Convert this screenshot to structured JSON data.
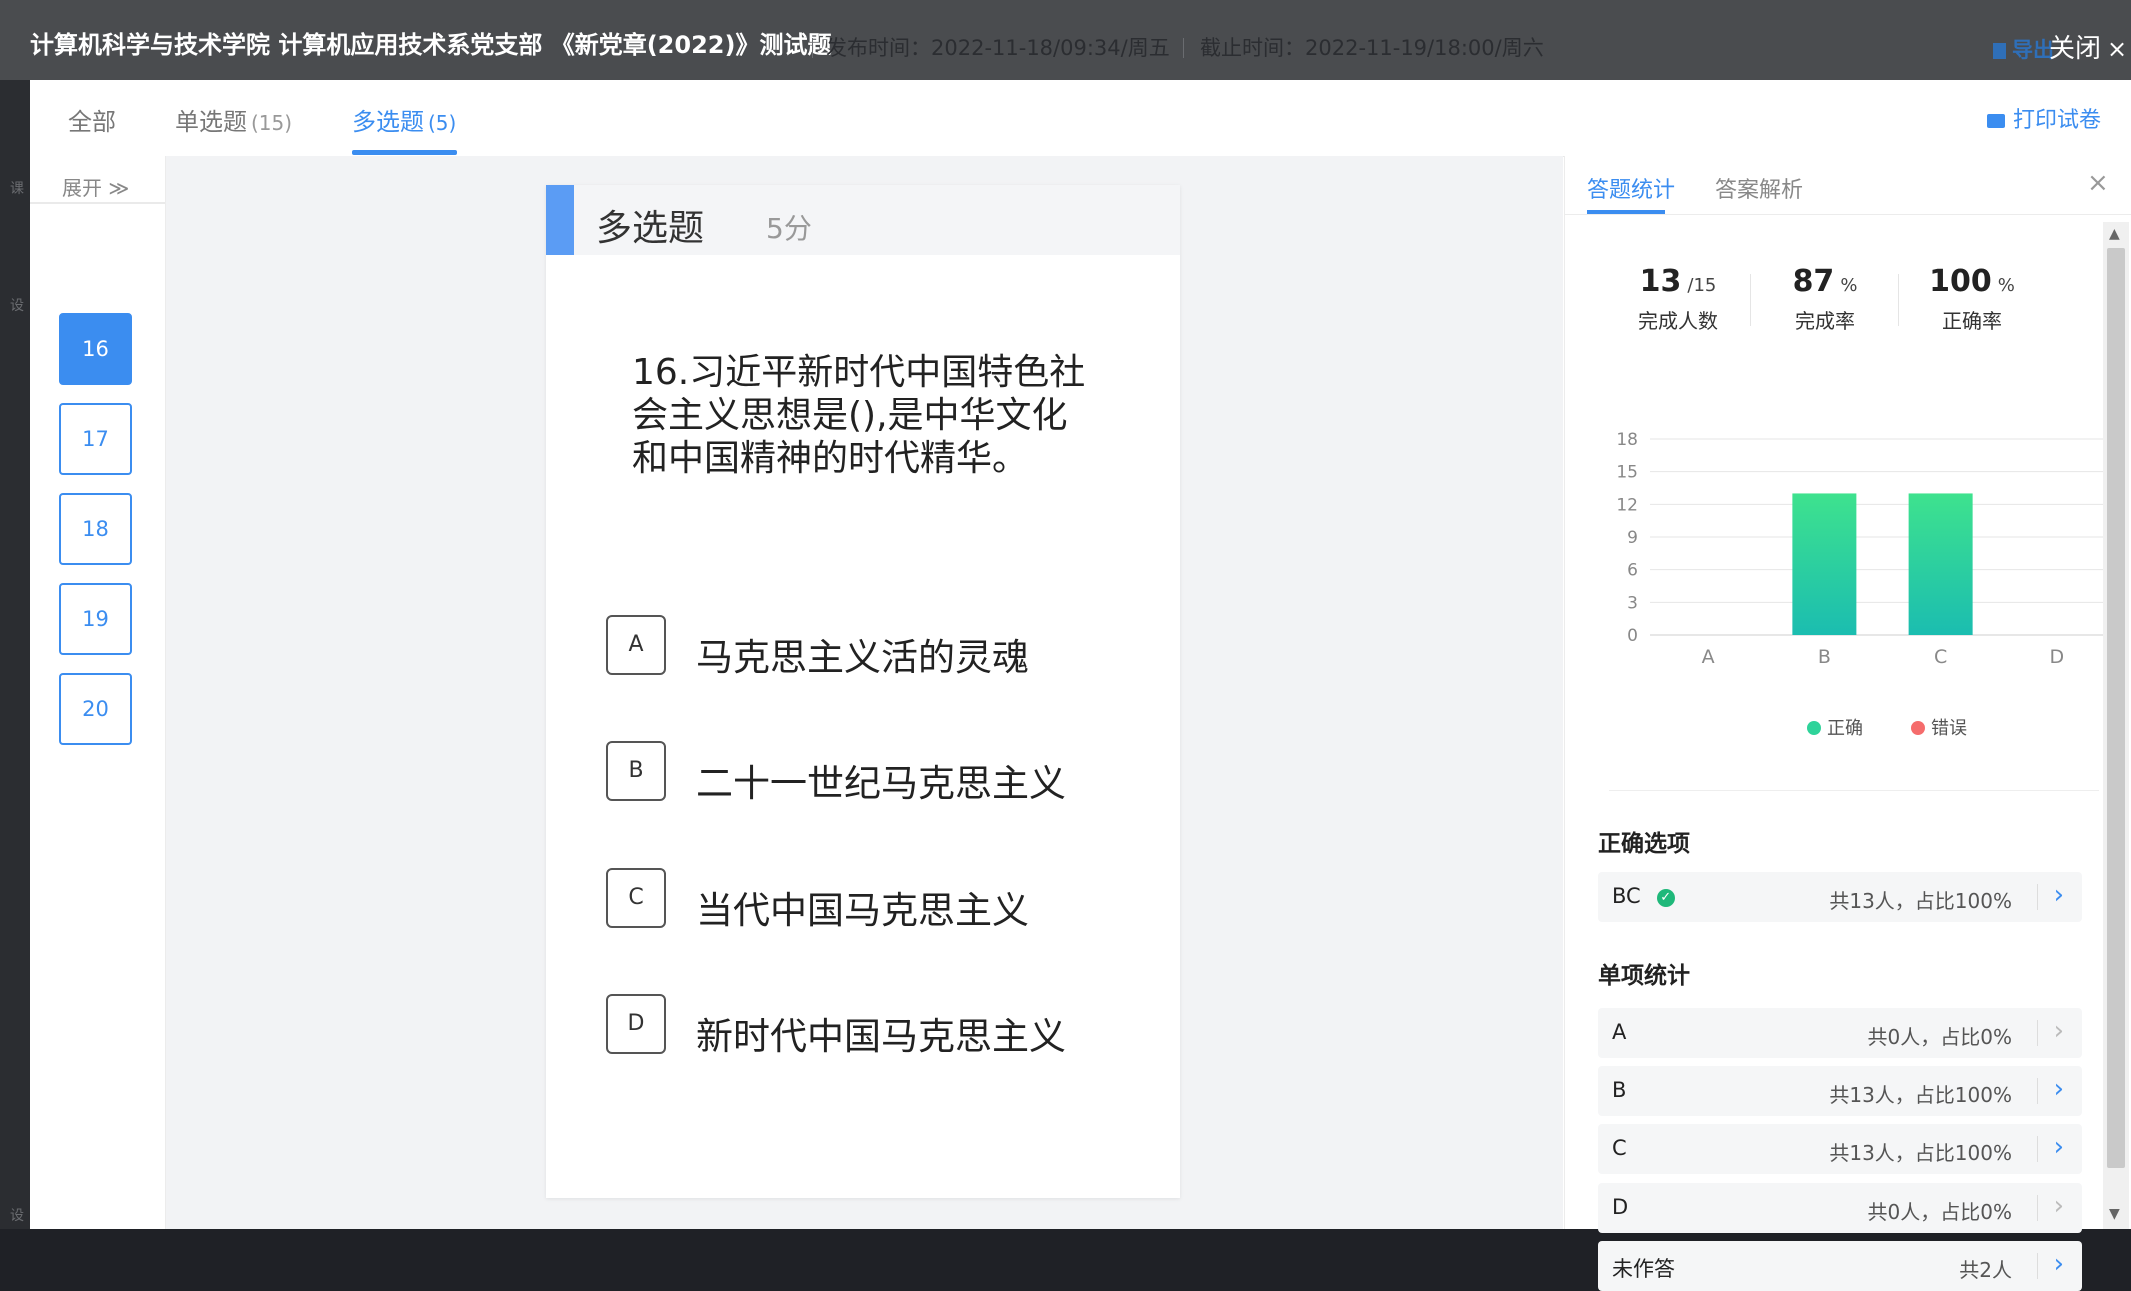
{
  "header": {
    "title": "计算机科学与技术学院 计算机应用技术系党支部 《新党章(2022)》测试题",
    "publish_time": "发布时间：2022-11-18/09:34/周五",
    "deadline": "截止时间：2022-11-19/18:00/周六",
    "export_label": "导出",
    "close_label": "关闭",
    "close_icon": "×"
  },
  "left_strip": {
    "chars": [
      "课",
      "设",
      "设"
    ]
  },
  "tabs": [
    {
      "label": "全部",
      "count": ""
    },
    {
      "label": "单选题",
      "count": "(15)"
    },
    {
      "label": "多选题",
      "count": "(5)"
    }
  ],
  "print_label": "打印试卷",
  "sidebar": {
    "expand_label": "展开 ≫",
    "numbers": [
      "16",
      "17",
      "18",
      "19",
      "20"
    ],
    "active": "16"
  },
  "question": {
    "type": "多选题",
    "score": "5分",
    "text": "16.习近平新时代中国特色社会主义思想是(),是中华文化和中国精神的时代精华。",
    "options": [
      {
        "letter": "A",
        "text": "马克思主义活的灵魂"
      },
      {
        "letter": "B",
        "text": "二十一世纪马克思主义"
      },
      {
        "letter": "C",
        "text": "当代中国马克思主义"
      },
      {
        "letter": "D",
        "text": "新时代中国马克思主义"
      }
    ]
  },
  "right_panel": {
    "tabs": [
      "答题统计",
      "答案解析"
    ],
    "close_icon": "×",
    "stats": [
      {
        "num": "13",
        "unit": "/15",
        "label": "完成人数"
      },
      {
        "num": "87",
        "unit": "%",
        "label": "完成率"
      },
      {
        "num": "100",
        "unit": "%",
        "label": "正确率"
      }
    ],
    "legend": [
      {
        "label": "正确",
        "color": "#2fd39a"
      },
      {
        "label": "错误",
        "color": "#f56c6c"
      }
    ],
    "correct_section_title": "正确选项",
    "correct_option": {
      "label": "BC",
      "value": "共13人，占比100%"
    },
    "single_section_title": "单项统计",
    "single_stats": [
      {
        "label": "A",
        "value": "共0人，占比0%",
        "active": false
      },
      {
        "label": "B",
        "value": "共13人，占比100%",
        "active": true
      },
      {
        "label": "C",
        "value": "共13人，占比100%",
        "active": true
      },
      {
        "label": "D",
        "value": "共0人，占比0%",
        "active": false
      },
      {
        "label": "未作答",
        "value": "共2人",
        "active": true
      }
    ]
  },
  "chart_data": {
    "type": "bar",
    "categories": [
      "A",
      "B",
      "C",
      "D"
    ],
    "series": [
      {
        "name": "正确",
        "values": [
          0,
          13,
          13,
          0
        ],
        "color": "#2fd39a"
      },
      {
        "name": "错误",
        "values": [
          0,
          0,
          0,
          0
        ],
        "color": "#f56c6c"
      }
    ],
    "yticks": [
      0,
      3,
      6,
      9,
      12,
      15,
      18
    ],
    "ylim": [
      0,
      18
    ],
    "grid": true,
    "legend_position": "bottom"
  }
}
